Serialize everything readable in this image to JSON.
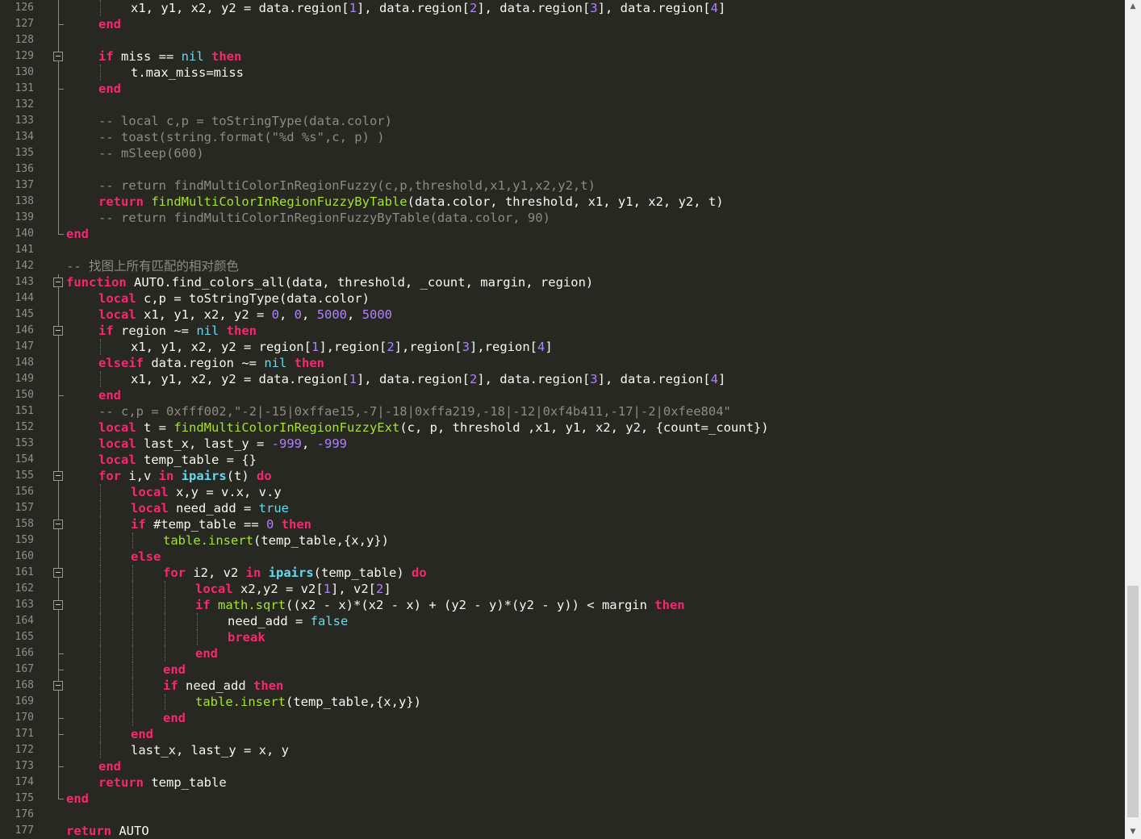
{
  "editor": {
    "language": "lua",
    "theme": {
      "background": "#272822",
      "keyword": "#f92672",
      "comment": "#8c8c84",
      "number": "#ae81ff",
      "function": "#a6e22e",
      "builtin": "#66d9ef",
      "text": "#f8f8f2"
    },
    "lines": [
      {
        "num": "126",
        "indent": 2,
        "tokens": [
          [
            "x1, y1, x2, y2 = data.region",
            "p"
          ],
          [
            "[",
            "p"
          ],
          [
            "1",
            "n"
          ],
          [
            "], data.region[",
            "p"
          ],
          [
            "2",
            "n"
          ],
          [
            "], data.region[",
            "p"
          ],
          [
            "3",
            "n"
          ],
          [
            "], data.region[",
            "p"
          ],
          [
            "4",
            "n"
          ],
          [
            "]",
            "p"
          ]
        ]
      },
      {
        "num": "127",
        "indent": 1,
        "tokens": [
          [
            "end",
            "k"
          ]
        ]
      },
      {
        "num": "128",
        "indent": 0,
        "tokens": []
      },
      {
        "num": "129",
        "indent": 1,
        "tokens": [
          [
            "if",
            "k"
          ],
          [
            " miss == ",
            "p"
          ],
          [
            "nil",
            "b"
          ],
          [
            " ",
            "p"
          ],
          [
            "then",
            "k"
          ]
        ]
      },
      {
        "num": "130",
        "indent": 2,
        "tokens": [
          [
            "t.max_miss=miss",
            "p"
          ]
        ]
      },
      {
        "num": "131",
        "indent": 1,
        "tokens": [
          [
            "end",
            "k"
          ]
        ]
      },
      {
        "num": "132",
        "indent": 0,
        "tokens": []
      },
      {
        "num": "133",
        "indent": 1,
        "tokens": [
          [
            "-- local c,p = toStringType(data.color)",
            "c"
          ]
        ]
      },
      {
        "num": "134",
        "indent": 1,
        "tokens": [
          [
            "-- toast(string.format(\"%d %s\",c, p) )",
            "c"
          ]
        ]
      },
      {
        "num": "135",
        "indent": 1,
        "tokens": [
          [
            "-- mSleep(600)",
            "c"
          ]
        ]
      },
      {
        "num": "136",
        "indent": 0,
        "tokens": []
      },
      {
        "num": "137",
        "indent": 1,
        "tokens": [
          [
            "-- return findMultiColorInRegionFuzzy(c,p,threshold,x1,y1,x2,y2,t)",
            "c"
          ]
        ]
      },
      {
        "num": "138",
        "indent": 1,
        "tokens": [
          [
            "return",
            "k"
          ],
          [
            " ",
            "p"
          ],
          [
            "findMultiColorInRegionFuzzyByTable",
            "f"
          ],
          [
            "(data.color, threshold, x1, y1, x2, y2, t)",
            "p"
          ]
        ]
      },
      {
        "num": "139",
        "indent": 1,
        "tokens": [
          [
            "-- return findMultiColorInRegionFuzzyByTable(data.color, 90)",
            "c"
          ]
        ]
      },
      {
        "num": "140",
        "indent": 0,
        "tokens": [
          [
            "end",
            "k"
          ]
        ]
      },
      {
        "num": "141",
        "indent": 0,
        "tokens": []
      },
      {
        "num": "142",
        "indent": 0,
        "tokens": [
          [
            "-- 找图上所有匹配的相对颜色",
            "c"
          ]
        ]
      },
      {
        "num": "143",
        "indent": 0,
        "tokens": [
          [
            "function",
            "k"
          ],
          [
            " AUTO.find_colors_all(data, threshold, _count, margin, region)",
            "p"
          ]
        ]
      },
      {
        "num": "144",
        "indent": 1,
        "tokens": [
          [
            "local",
            "k"
          ],
          [
            " c,p = toStringType(data.color)",
            "p"
          ]
        ]
      },
      {
        "num": "145",
        "indent": 1,
        "tokens": [
          [
            "local",
            "k"
          ],
          [
            " x1, y1, x2, y2 = ",
            "p"
          ],
          [
            "0",
            "n"
          ],
          [
            ", ",
            "p"
          ],
          [
            "0",
            "n"
          ],
          [
            ", ",
            "p"
          ],
          [
            "5000",
            "n"
          ],
          [
            ", ",
            "p"
          ],
          [
            "5000",
            "n"
          ]
        ]
      },
      {
        "num": "146",
        "indent": 1,
        "tokens": [
          [
            "if",
            "k"
          ],
          [
            " region ~= ",
            "p"
          ],
          [
            "nil",
            "b"
          ],
          [
            " ",
            "p"
          ],
          [
            "then",
            "k"
          ]
        ]
      },
      {
        "num": "147",
        "indent": 2,
        "tokens": [
          [
            "x1, y1, x2, y2 = region[",
            "p"
          ],
          [
            "1",
            "n"
          ],
          [
            "],region[",
            "p"
          ],
          [
            "2",
            "n"
          ],
          [
            "],region[",
            "p"
          ],
          [
            "3",
            "n"
          ],
          [
            "],region[",
            "p"
          ],
          [
            "4",
            "n"
          ],
          [
            "]",
            "p"
          ]
        ]
      },
      {
        "num": "148",
        "indent": 1,
        "tokens": [
          [
            "elseif",
            "k"
          ],
          [
            " data.region ~= ",
            "p"
          ],
          [
            "nil",
            "b"
          ],
          [
            " ",
            "p"
          ],
          [
            "then",
            "k"
          ]
        ]
      },
      {
        "num": "149",
        "indent": 2,
        "tokens": [
          [
            "x1, y1, x2, y2 = data.region[",
            "p"
          ],
          [
            "1",
            "n"
          ],
          [
            "], data.region[",
            "p"
          ],
          [
            "2",
            "n"
          ],
          [
            "], data.region[",
            "p"
          ],
          [
            "3",
            "n"
          ],
          [
            "], data.region[",
            "p"
          ],
          [
            "4",
            "n"
          ],
          [
            "]",
            "p"
          ]
        ]
      },
      {
        "num": "150",
        "indent": 1,
        "tokens": [
          [
            "end",
            "k"
          ]
        ]
      },
      {
        "num": "151",
        "indent": 1,
        "tokens": [
          [
            "-- c,p = 0xfff002,\"-2|-15|0xffae15,-7|-18|0xffa219,-18|-12|0xf4b411,-17|-2|0xfee804\"",
            "c"
          ]
        ]
      },
      {
        "num": "152",
        "indent": 1,
        "tokens": [
          [
            "local",
            "k"
          ],
          [
            " t = ",
            "p"
          ],
          [
            "findMultiColorInRegionFuzzyExt",
            "f"
          ],
          [
            "(c, p, threshold ,x1, y1, x2, y2, {count=_count})",
            "p"
          ]
        ]
      },
      {
        "num": "153",
        "indent": 1,
        "tokens": [
          [
            "local",
            "k"
          ],
          [
            " last_x, last_y = ",
            "p"
          ],
          [
            "-999",
            "n"
          ],
          [
            ", ",
            "p"
          ],
          [
            "-999",
            "n"
          ]
        ]
      },
      {
        "num": "154",
        "indent": 1,
        "tokens": [
          [
            "local",
            "k"
          ],
          [
            " temp_table = {}",
            "p"
          ]
        ]
      },
      {
        "num": "155",
        "indent": 1,
        "tokens": [
          [
            "for",
            "k"
          ],
          [
            " i,v ",
            "p"
          ],
          [
            "in",
            "k"
          ],
          [
            " ",
            "p"
          ],
          [
            "ipairs",
            "bb"
          ],
          [
            "(t) ",
            "p"
          ],
          [
            "do",
            "k"
          ]
        ]
      },
      {
        "num": "156",
        "indent": 2,
        "tokens": [
          [
            "local",
            "k"
          ],
          [
            " x,y = v.x, v.y",
            "p"
          ]
        ]
      },
      {
        "num": "157",
        "indent": 2,
        "tokens": [
          [
            "local",
            "k"
          ],
          [
            " need_add = ",
            "p"
          ],
          [
            "true",
            "b"
          ]
        ]
      },
      {
        "num": "158",
        "indent": 2,
        "tokens": [
          [
            "if",
            "k"
          ],
          [
            " #temp_table == ",
            "p"
          ],
          [
            "0",
            "n"
          ],
          [
            " ",
            "p"
          ],
          [
            "then",
            "k"
          ]
        ]
      },
      {
        "num": "159",
        "indent": 3,
        "tokens": [
          [
            "table.insert",
            "f"
          ],
          [
            "(temp_table,{x,y})",
            "p"
          ]
        ]
      },
      {
        "num": "160",
        "indent": 2,
        "tokens": [
          [
            "else",
            "k"
          ]
        ]
      },
      {
        "num": "161",
        "indent": 3,
        "tokens": [
          [
            "for",
            "k"
          ],
          [
            " i2, v2 ",
            "p"
          ],
          [
            "in",
            "k"
          ],
          [
            " ",
            "p"
          ],
          [
            "ipairs",
            "bb"
          ],
          [
            "(temp_table) ",
            "p"
          ],
          [
            "do",
            "k"
          ]
        ]
      },
      {
        "num": "162",
        "indent": 4,
        "tokens": [
          [
            "local",
            "k"
          ],
          [
            " x2,y2 = v2[",
            "p"
          ],
          [
            "1",
            "n"
          ],
          [
            "], v2[",
            "p"
          ],
          [
            "2",
            "n"
          ],
          [
            "]",
            "p"
          ]
        ]
      },
      {
        "num": "163",
        "indent": 4,
        "tokens": [
          [
            "if",
            "k"
          ],
          [
            " ",
            "p"
          ],
          [
            "math.sqrt",
            "f"
          ],
          [
            "((x2 - x)*(x2 - x) + (y2 - y)*(y2 - y)) < margin ",
            "p"
          ],
          [
            "then",
            "k"
          ]
        ]
      },
      {
        "num": "164",
        "indent": 5,
        "tokens": [
          [
            "need_add = ",
            "p"
          ],
          [
            "false",
            "b"
          ]
        ]
      },
      {
        "num": "165",
        "indent": 5,
        "tokens": [
          [
            "break",
            "k"
          ]
        ]
      },
      {
        "num": "166",
        "indent": 4,
        "tokens": [
          [
            "end",
            "k"
          ]
        ]
      },
      {
        "num": "167",
        "indent": 3,
        "tokens": [
          [
            "end",
            "k"
          ]
        ]
      },
      {
        "num": "168",
        "indent": 3,
        "tokens": [
          [
            "if",
            "k"
          ],
          [
            " need_add ",
            "p"
          ],
          [
            "then",
            "k"
          ]
        ]
      },
      {
        "num": "169",
        "indent": 4,
        "tokens": [
          [
            "table.insert",
            "f"
          ],
          [
            "(temp_table,{x,y})",
            "p"
          ]
        ]
      },
      {
        "num": "170",
        "indent": 3,
        "tokens": [
          [
            "end",
            "k"
          ]
        ]
      },
      {
        "num": "171",
        "indent": 2,
        "tokens": [
          [
            "end",
            "k"
          ]
        ]
      },
      {
        "num": "172",
        "indent": 2,
        "tokens": [
          [
            "last_x, last_y = x, y",
            "p"
          ]
        ]
      },
      {
        "num": "173",
        "indent": 1,
        "tokens": [
          [
            "end",
            "k"
          ]
        ]
      },
      {
        "num": "174",
        "indent": 1,
        "tokens": [
          [
            "return",
            "k"
          ],
          [
            " temp_table",
            "p"
          ]
        ]
      },
      {
        "num": "175",
        "indent": 0,
        "tokens": [
          [
            "end",
            "k"
          ]
        ]
      },
      {
        "num": "176",
        "indent": 0,
        "tokens": []
      },
      {
        "num": "177",
        "indent": 0,
        "tokens": [
          [
            "return",
            "k"
          ],
          [
            " AUTO",
            "p"
          ]
        ]
      }
    ],
    "fold_markers": [
      "129",
      "143",
      "146",
      "155",
      "158",
      "161",
      "163",
      "168"
    ],
    "scrollbar": {
      "up_arrow": "▲",
      "down_arrow": "▼",
      "scroll_position": 0.92
    }
  }
}
